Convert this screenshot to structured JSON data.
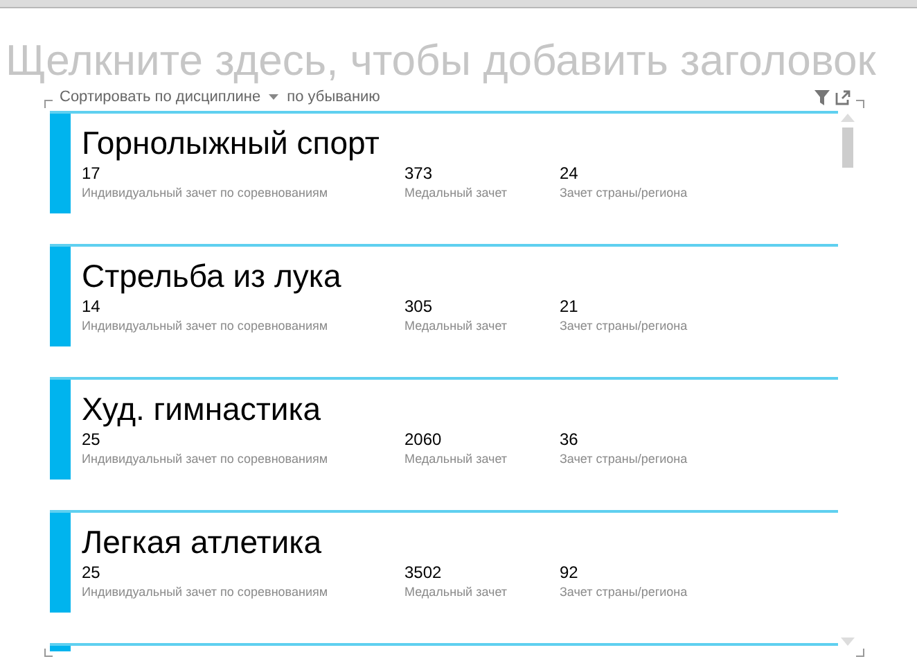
{
  "title_placeholder": "Щелкните здесь, чтобы добавить заголовок",
  "sort_bar": {
    "sort_label": "Сортировать по дисциплине",
    "order": "по убыванию"
  },
  "cards": [
    {
      "title": "Горнолыжный спорт",
      "fields": [
        {
          "value": "17",
          "label": "Индивидуальный зачет по соревнованиям"
        },
        {
          "value": "373",
          "label": "Медальный зачет"
        },
        {
          "value": "24",
          "label": "Зачет страны/региона"
        }
      ]
    },
    {
      "title": "Стрельба из лука",
      "fields": [
        {
          "value": "14",
          "label": "Индивидуальный зачет по соревнованиям"
        },
        {
          "value": "305",
          "label": "Медальный зачет"
        },
        {
          "value": "21",
          "label": "Зачет страны/региона"
        }
      ]
    },
    {
      "title": "Худ. гимнастика",
      "fields": [
        {
          "value": "25",
          "label": "Индивидуальный зачет по соревнованиям"
        },
        {
          "value": "2060",
          "label": "Медальный зачет"
        },
        {
          "value": "36",
          "label": "Зачет страны/региона"
        }
      ]
    },
    {
      "title": "Легкая атлетика",
      "fields": [
        {
          "value": "25",
          "label": "Индивидуальный зачет по соревнованиям"
        },
        {
          "value": "3502",
          "label": "Медальный зачет"
        },
        {
          "value": "92",
          "label": "Зачет страны/региона"
        }
      ]
    }
  ]
}
